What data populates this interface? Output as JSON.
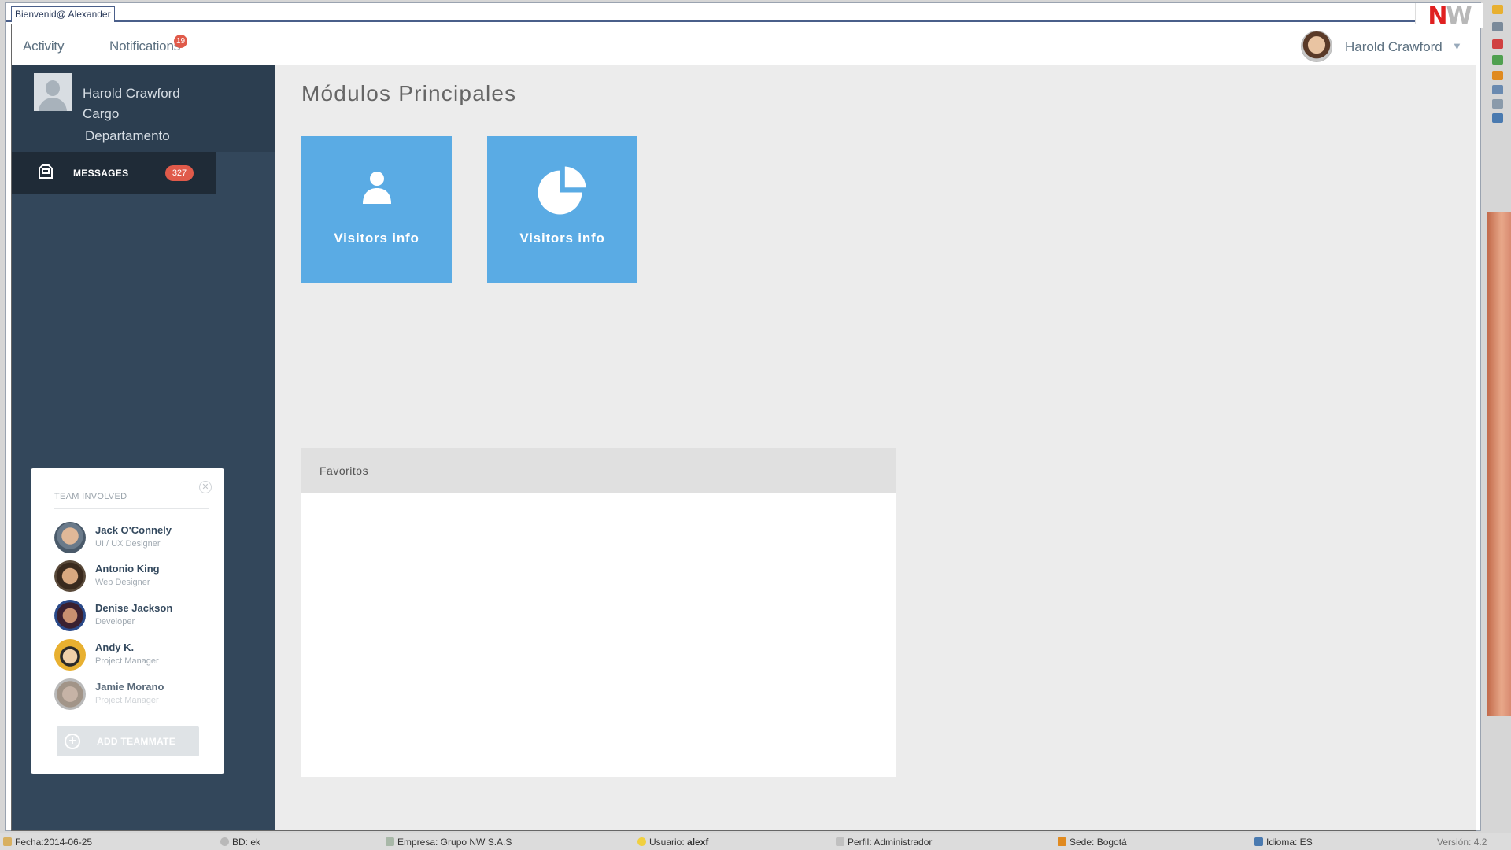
{
  "window": {
    "tab_title": "Bienvenid@ Alexander"
  },
  "header": {
    "nav": [
      {
        "label": "Activity"
      },
      {
        "label": "Notifications",
        "badge": "19"
      }
    ],
    "user_name": "Harold Crawford"
  },
  "profile": {
    "name": "Harold Crawford",
    "role": "Cargo",
    "department": "Departamento"
  },
  "messages": {
    "label": "MESSAGES",
    "count": "327"
  },
  "team": {
    "title": "TEAM INVOLVED",
    "members": [
      {
        "name": "Jack O'Connely",
        "role": "UI / UX Designer"
      },
      {
        "name": "Antonio King",
        "role": "Web Designer"
      },
      {
        "name": "Denise Jackson",
        "role": "Developer"
      },
      {
        "name": "Andy K.",
        "role": "Project Manager"
      },
      {
        "name": "Jamie Morano",
        "role": "Project Manager"
      }
    ],
    "add_label": "ADD TEAMMATE"
  },
  "main": {
    "title": "Módulos Principales",
    "tiles": [
      {
        "label": "Visitors info",
        "icon": "user-icon"
      },
      {
        "label": "Visitors info",
        "icon": "pie-chart-icon"
      }
    ],
    "favorites_title": "Favoritos"
  },
  "statusbar": {
    "fecha": "Fecha:2014-06-25",
    "bd": "BD: ek",
    "empresa": "Empresa: Grupo NW S.A.S",
    "usuario_label": "Usuario:",
    "usuario_value": "alexf",
    "perfil": "Perfil: Administrador",
    "sede": "Sede: Bogotá",
    "idioma": "Idioma: ES",
    "version": "Versión: 4.2"
  },
  "colors": {
    "sidebar": "#33475b",
    "tile": "#5aabe4",
    "badge": "#e05a4a"
  }
}
